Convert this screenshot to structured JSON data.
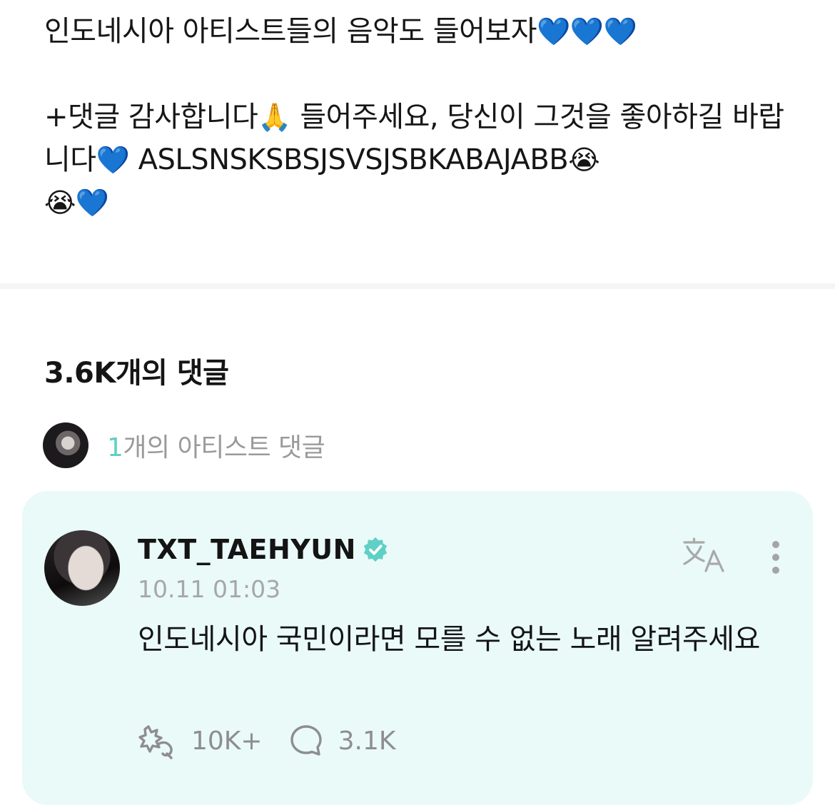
{
  "post": {
    "line1": "인도네시아 아티스트들의 음악도 들어보자",
    "line1_emoji": "💙💙💙",
    "line2": "+댓글 감사합니다",
    "line2_emoji": "🙏",
    "line2_cont": " 들어주세요, 당신이 그것을 좋아하길 바랍니다",
    "line2_emoji2": "💙",
    "line2_tail": " ASLSNSKSBSJSVSJSBKABAJABB",
    "line2_emoji3": "😭",
    "line3_emoji": "😭",
    "line3_heart": "💙"
  },
  "comments": {
    "title": "3.6K개의 댓글",
    "artist_count_num": "1",
    "artist_count_text": "개의 아티스트 댓글"
  },
  "comment": {
    "username": "TXT_TAEHYUN",
    "timestamp": "10.11 01:03",
    "text": "인도네시아 국민이라면 모를 수 없는 노래 알려주세요",
    "likes": "10K+",
    "replies": "3.1K"
  },
  "icons": {
    "verified": "verified-badge-icon",
    "translate": "translate-icon",
    "more": "more-vertical-icon",
    "like": "like-icon",
    "reply": "reply-bubble-icon"
  },
  "colors": {
    "accent": "#5fd0c5",
    "card_bg": "#e9faf8",
    "heart": "#1e73ff"
  }
}
